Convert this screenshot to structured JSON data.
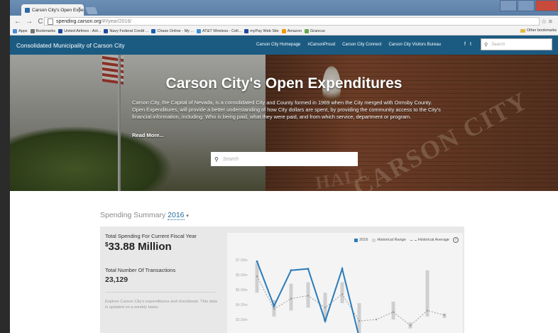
{
  "browser": {
    "tab_title": "Carson City's Open Expe",
    "url_host": "spending.carson.org",
    "url_path": "/#!/year/2016/",
    "bookmarks": [
      {
        "label": "Apps",
        "color": "#4a8cd8"
      },
      {
        "label": "Bookmarks",
        "color": "#777777"
      },
      {
        "label": "United Airlines - Airl...",
        "color": "#1f4aa0"
      },
      {
        "label": "Navy Federal Credit ...",
        "color": "#1f4aa0"
      },
      {
        "label": "Chase Online - My ...",
        "color": "#1a5fb4"
      },
      {
        "label": "AT&T Wireless - Cell...",
        "color": "#3c8fd6"
      },
      {
        "label": "myPay Web Site",
        "color": "#1f4aa0"
      },
      {
        "label": "Amazon",
        "color": "#f29900"
      },
      {
        "label": "Grancus",
        "color": "#6aa84f"
      }
    ],
    "other_bookmarks": "Other bookmarks"
  },
  "site": {
    "brand": "Consolidated Municipality of Carson City",
    "nav": [
      "Carson City Homepage",
      "#CarsonProud",
      "Carson City Connect",
      "Carson City Visitors Bureau"
    ],
    "social": [
      "f",
      "t"
    ],
    "search_placeholder": "Search"
  },
  "hero": {
    "title": "Carson City's Open Expenditures",
    "description": "Carson City, the Capital of Nevada, is a consolidated City and County formed in 1969 when the City merged with Ormsby County. Open Expenditures, will provide a better understanding of how City dollars are spent, by providing the community access to the City's financial information, including: Who is being paid, what they were paid, and from which service, department or program.",
    "read_more": "Read More...",
    "search_placeholder": "Search",
    "engraving_1": "CARSON CITY",
    "engraving_2": "HALL"
  },
  "summary": {
    "heading": "Spending Summary",
    "year": "2016",
    "total_label": "Total Spending For Current Fiscal Year",
    "total_currency": "$",
    "total_value": "33.88 Million",
    "tx_label": "Total Number Of Transactions",
    "tx_value": "23,129",
    "note": "Explore Carson City's expenditures and checkbook. This data is updated on a weekly basis."
  },
  "chart_data": {
    "type": "line",
    "legend": [
      "2016",
      "Historical Range",
      "Historical Average"
    ],
    "colors": {
      "2016": "#2b7bb9",
      "range": "#cfcfcf",
      "average": "#9a9a9a"
    },
    "y_ticks": [
      "$7.00m",
      "$6.00m",
      "$5.00m",
      "$4.00m",
      "$3.00m",
      "$2.00m"
    ],
    "ylim": [
      2.0,
      7.0
    ],
    "x": [
      1,
      2,
      3,
      4,
      5,
      6,
      7,
      8,
      9,
      10,
      11,
      12
    ],
    "series_2016": [
      6.9,
      3.9,
      6.3,
      6.4,
      2.9,
      6.4,
      1.8,
      null,
      null,
      null,
      null,
      null
    ],
    "historical_average": [
      5.9,
      3.7,
      4.4,
      4.6,
      3.8,
      4.7,
      2.9,
      3.0,
      3.5,
      2.6,
      3.6,
      3.3
    ],
    "historical_range": [
      [
        4.8,
        6.8
      ],
      [
        3.2,
        4.3
      ],
      [
        3.6,
        5.4
      ],
      [
        3.8,
        5.5
      ],
      [
        2.9,
        4.8
      ],
      [
        4.1,
        5.5
      ],
      [
        1.9,
        4.1
      ],
      [
        null,
        null
      ],
      [
        3.0,
        4.2
      ],
      [
        2.4,
        2.8
      ],
      [
        3.2,
        6.3
      ],
      [
        3.1,
        3.4
      ]
    ]
  }
}
